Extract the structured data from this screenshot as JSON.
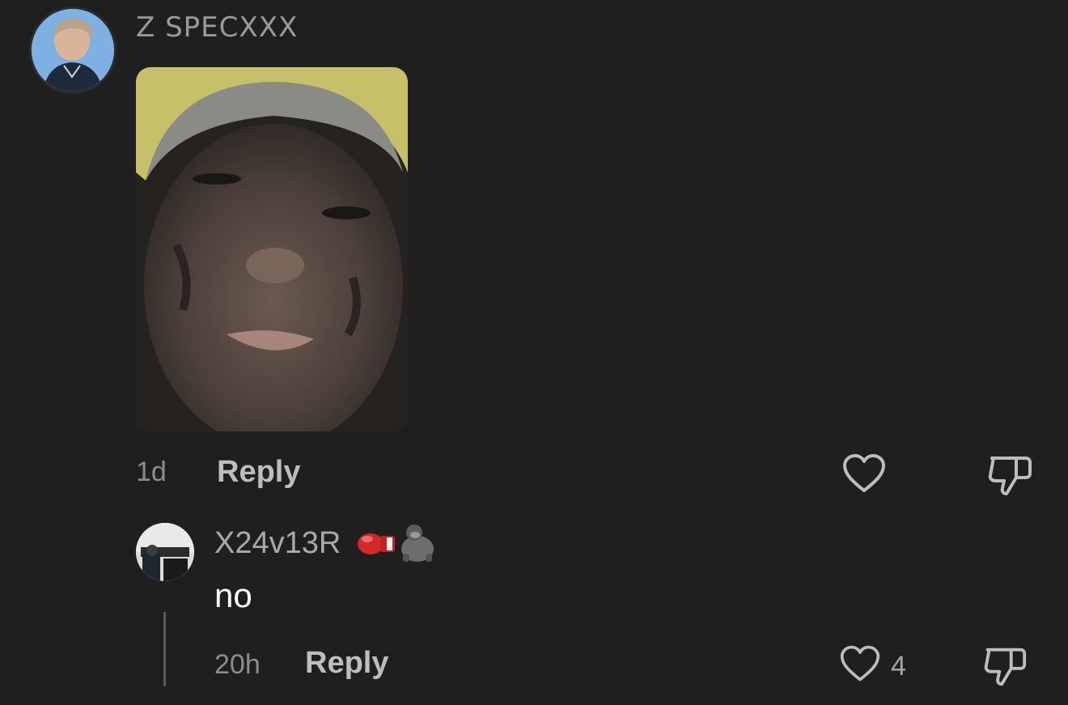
{
  "comment": {
    "username": "Z SPECXXX",
    "age": "1d",
    "reply_label": "Reply",
    "like_icon": "heart-outline-icon",
    "dislike_icon": "thumbs-down-outline-icon"
  },
  "reply": {
    "username": "X24v13R",
    "badges": [
      "boxing-glove-emoji",
      "gorilla-emoji"
    ],
    "text": "no",
    "age": "20h",
    "reply_label": "Reply",
    "like_count": "4",
    "like_icon": "heart-outline-icon",
    "dislike_icon": "thumbs-down-outline-icon"
  },
  "colors": {
    "background": "#1f1f1f",
    "muted_text": "#8d8d8d",
    "action_text": "#bdbdbd",
    "primary_text": "#ffffff",
    "icon": "#bdbdbd"
  }
}
